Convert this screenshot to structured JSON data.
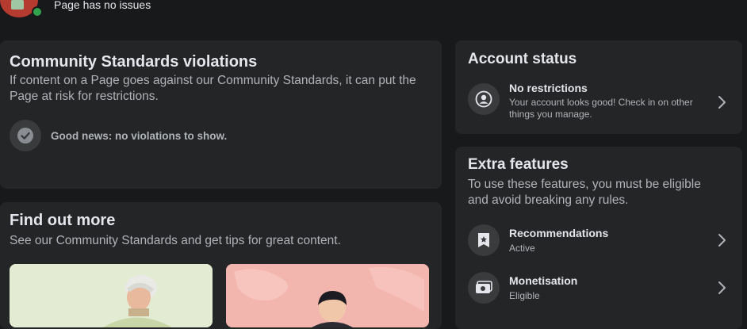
{
  "header": {
    "status": "Page has no issues"
  },
  "violations": {
    "title": "Community Standards violations",
    "description": "If content on a Page goes against our Community Standards, it can put the Page at risk for restrictions.",
    "message": "Good news: no violations to show."
  },
  "find_out_more": {
    "title": "Find out more",
    "description": "See our Community Standards and get tips for great content."
  },
  "account_status": {
    "title": "Account status",
    "item_title": "No restrictions",
    "item_desc": "Your account looks good! Check in on other things you manage."
  },
  "extra_features": {
    "title": "Extra features",
    "description": "To use these features, you must be eligible and avoid breaking any rules.",
    "items": [
      {
        "title": "Recommendations",
        "status": "Active",
        "icon": "recommendations-icon"
      },
      {
        "title": "Monetisation",
        "status": "Eligible",
        "icon": "monetisation-icon"
      }
    ]
  },
  "colors": {
    "background": "#18191a",
    "card": "#242526",
    "chip": "#3a3b3c",
    "online": "#31a24c"
  }
}
